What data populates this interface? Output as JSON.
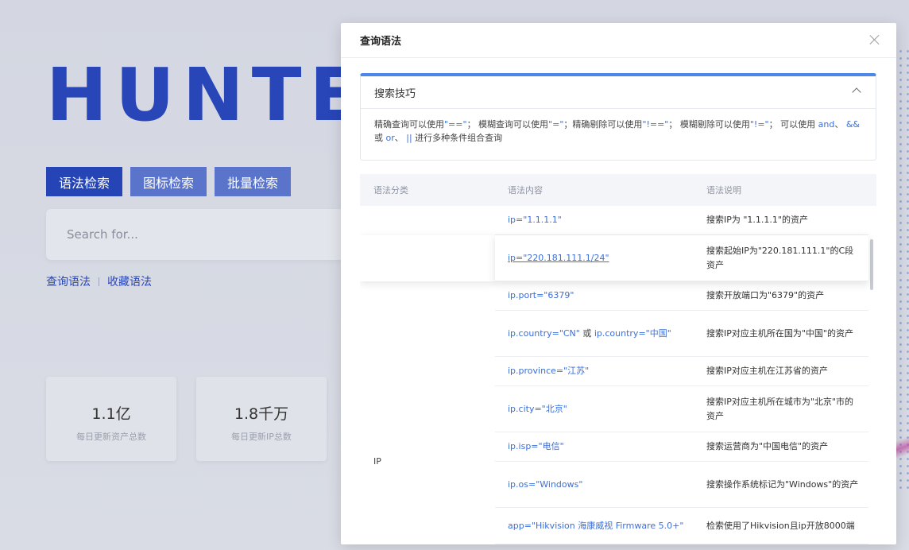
{
  "background": {
    "logo": "HUNTEF",
    "tabs": [
      "语法检索",
      "图标检索",
      "批量检索"
    ],
    "search_placeholder": "Search for...",
    "links": [
      "查询语法",
      "收藏语法"
    ],
    "stats": [
      {
        "value": "1.1亿",
        "label": "每日更新资产总数"
      },
      {
        "value": "1.8千万",
        "label": "每日更新IP总数"
      }
    ]
  },
  "modal": {
    "title": "查询语法",
    "tips": {
      "title": "搜索技巧",
      "body": [
        {
          "t": "精确查询可以使用",
          "h": false
        },
        {
          "t": "\"==\"",
          "h": true
        },
        {
          "t": "； 模糊查询可以使用",
          "h": false
        },
        {
          "t": "\"=\"",
          "h": true
        },
        {
          "t": "；精确剔除可以使用",
          "h": false
        },
        {
          "t": "\"!==\"",
          "h": true
        },
        {
          "t": "； 模糊剔除可以使用",
          "h": false
        },
        {
          "t": "\"!=\"",
          "h": true
        },
        {
          "t": "； 可以使用 ",
          "h": false
        },
        {
          "t": "and",
          "h": true
        },
        {
          "t": "、 ",
          "h": false
        },
        {
          "t": "&&",
          "h": true
        },
        {
          "t": "或 ",
          "h": false
        },
        {
          "t": "or",
          "h": true
        },
        {
          "t": "、 ",
          "h": false
        },
        {
          "t": "||",
          "h": true
        },
        {
          "t": " 进行多种条件组合查询",
          "h": false
        }
      ]
    },
    "table": {
      "headers": [
        "语法分类",
        "语法内容",
        "语法说明"
      ],
      "category": "IP",
      "rows": [
        {
          "value": "ip=\"1.1.1.1\"",
          "desc": "搜索IP为 \"1.1.1.1\"的资产"
        },
        {
          "value": "ip=\"220.181.111.1/24\"",
          "desc": "搜索起始IP为\"220.181.111.1\"的C段资产",
          "link": true
        },
        {
          "value": "ip.port=\"6379\"",
          "desc": "搜索开放端口为\"6379\"的资产"
        },
        {
          "value": "ip.country=\"CN\" 或 ip.country=\"中国\"",
          "desc": "搜索IP对应主机所在国为\"中国\"的资产"
        },
        {
          "value": "ip.province=\"江苏\"",
          "desc": "搜索IP对应主机在江苏省的资产"
        },
        {
          "value": "ip.city=\"北京\"",
          "desc": "搜索IP对应主机所在城市为\"北京\"市的资产"
        },
        {
          "value": "ip.isp=\"电信\"",
          "desc": "搜索运营商为\"中国电信\"的资产"
        },
        {
          "value": "ip.os=\"Windows\"",
          "desc": "搜索操作系统标记为\"Windows\"的资产"
        },
        {
          "value": "app=\"Hikvision 海康威视 Firmware 5.0+\"",
          "desc": "检索使用了Hikvision且ip开放8000端"
        }
      ]
    }
  }
}
